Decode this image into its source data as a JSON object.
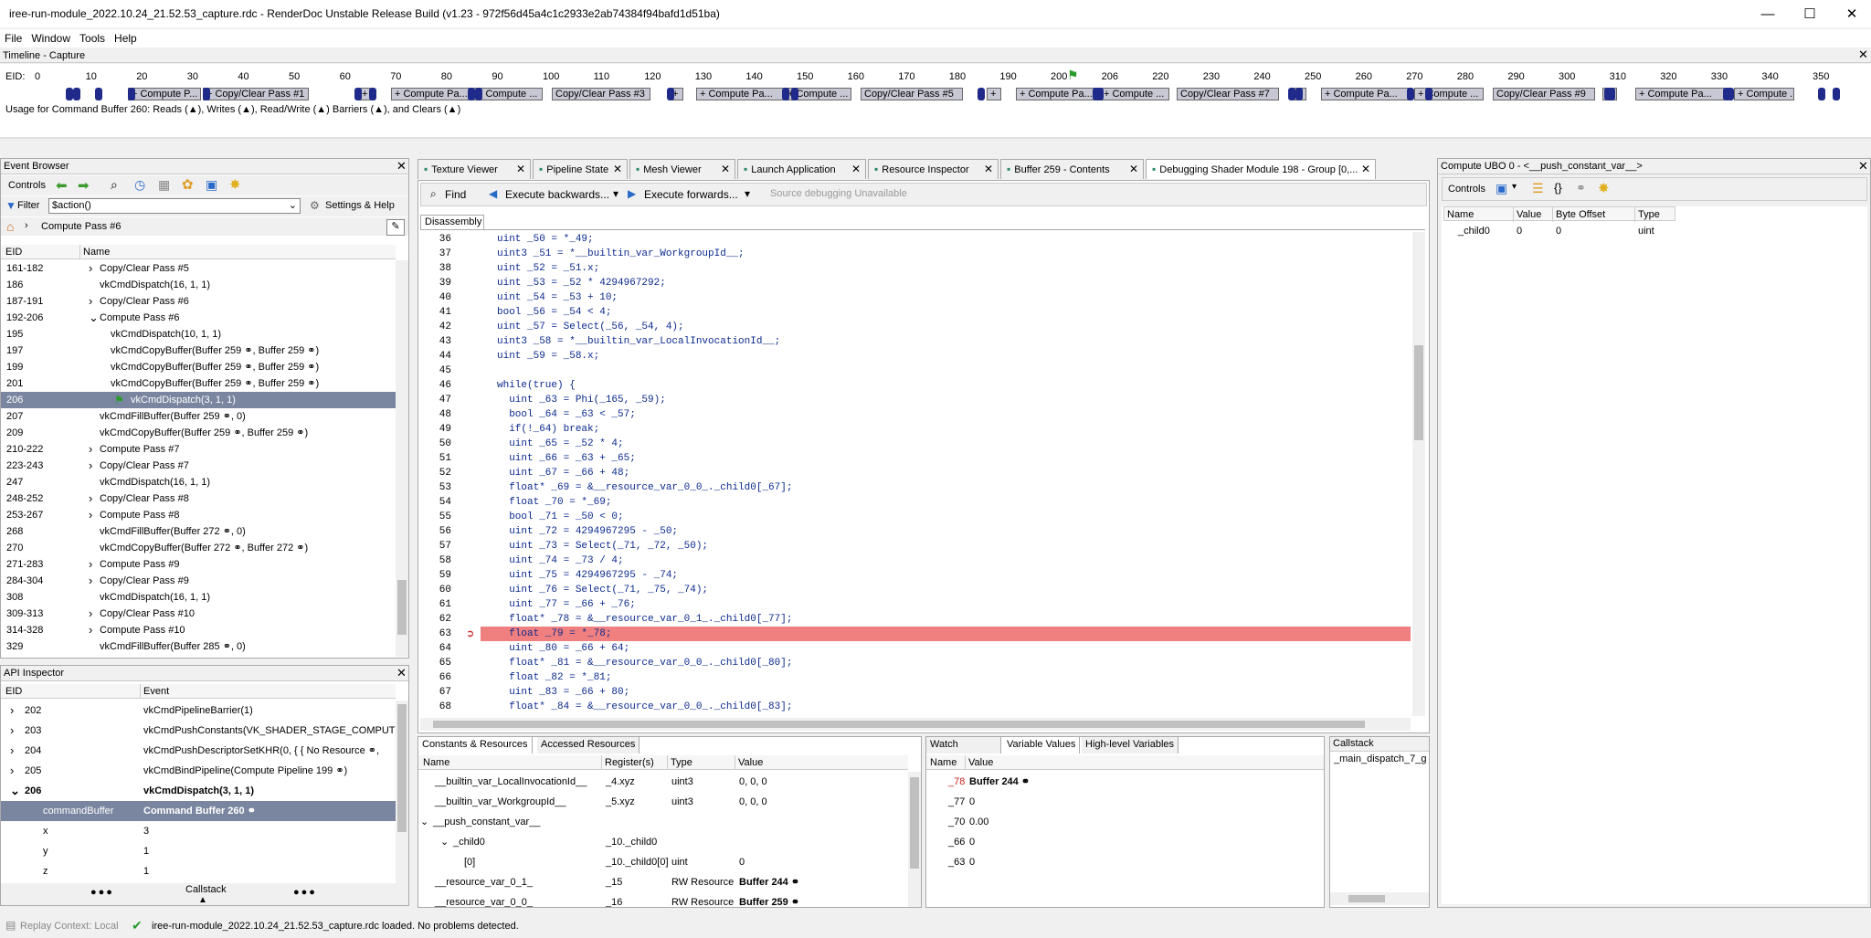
{
  "window": {
    "title": "iree-run-module_2022.10.24_21.52.53_capture.rdc - RenderDoc Unstable Release Build (v1.23 - 972f56d45a4c1c2933e2ab74384f94bafd1d51ba)",
    "minimize": "—",
    "maximize": "☐",
    "close": "✕"
  },
  "menu": [
    "File",
    "Window",
    "Tools",
    "Help"
  ],
  "timeline": {
    "title": "Timeline - Capture",
    "eid_label": "EID:",
    "ticks": [
      "0",
      "10",
      "20",
      "30",
      "40",
      "50",
      "60",
      "70",
      "80",
      "90",
      "100",
      "110",
      "120",
      "130",
      "140",
      "150",
      "160",
      "170",
      "180",
      "190",
      "200",
      "206",
      "220",
      "230",
      "240",
      "250",
      "260",
      "270",
      "280",
      "290",
      "300",
      "310",
      "320",
      "330",
      "340",
      "350"
    ],
    "segments": [
      "+ Compute P...",
      "+ Copy/Clear Pass #1",
      "+",
      "+ Compute Pa...",
      "+ Compute ...",
      "Copy/Clear Pass #3",
      "+",
      "+ Compute Pa...",
      "+ Compute ...",
      "Copy/Clear Pass #5",
      "+",
      "+ Compute Pa...",
      "+ Compute ...",
      "Copy/Clear Pass #7",
      "+",
      "+ Compute Pa...",
      "+ Compute ...",
      "Copy/Clear Pass #9",
      "+",
      "+ Compute Pa...",
      "+ Compute ..."
    ],
    "usage": "Usage for Command Buffer 260: Reads (▲), Writes (▲), Read/Write (▲) Barriers (▲), and Clears (▲)"
  },
  "event_browser": {
    "title": "Event Browser",
    "controls": "Controls",
    "filter_label": "Filter",
    "filter_value": "$action()",
    "settings": "Settings & Help",
    "breadcrumb": "Compute Pass #6",
    "col_eid": "EID",
    "col_name": "Name",
    "rows": [
      {
        "eid": "161-182",
        "name": "Copy/Clear Pass #5",
        "arrow": "›"
      },
      {
        "eid": "186",
        "name": "vkCmdDispatch(16, 1, 1)",
        "arrow": ""
      },
      {
        "eid": "187-191",
        "name": "Copy/Clear Pass #6",
        "arrow": "›"
      },
      {
        "eid": "192-206",
        "name": "Compute Pass #6",
        "arrow": "⌄"
      },
      {
        "eid": "195",
        "name": "vkCmdDispatch(10, 1, 1)",
        "arrow": ""
      },
      {
        "eid": "197",
        "name": "vkCmdCopyBuffer(Buffer 259 ⚭, Buffer 259 ⚭)",
        "arrow": ""
      },
      {
        "eid": "199",
        "name": "vkCmdCopyBuffer(Buffer 259 ⚭, Buffer 259 ⚭)",
        "arrow": ""
      },
      {
        "eid": "201",
        "name": "vkCmdCopyBuffer(Buffer 259 ⚭, Buffer 259 ⚭)",
        "arrow": ""
      },
      {
        "eid": "206",
        "name": "vkCmdDispatch(3, 1, 1)",
        "arrow": ""
      },
      {
        "eid": "207",
        "name": "vkCmdFillBuffer(Buffer 259 ⚭, 0)",
        "arrow": ""
      },
      {
        "eid": "209",
        "name": "vkCmdCopyBuffer(Buffer 259 ⚭, Buffer 259 ⚭)",
        "arrow": ""
      },
      {
        "eid": "210-222",
        "name": "Compute Pass #7",
        "arrow": "›"
      },
      {
        "eid": "223-243",
        "name": "Copy/Clear Pass #7",
        "arrow": "›"
      },
      {
        "eid": "247",
        "name": "vkCmdDispatch(16, 1, 1)",
        "arrow": ""
      },
      {
        "eid": "248-252",
        "name": "Copy/Clear Pass #8",
        "arrow": "›"
      },
      {
        "eid": "253-267",
        "name": "Compute Pass #8",
        "arrow": "›"
      },
      {
        "eid": "268",
        "name": "vkCmdFillBuffer(Buffer 272 ⚭, 0)",
        "arrow": ""
      },
      {
        "eid": "270",
        "name": "vkCmdCopyBuffer(Buffer 272 ⚭, Buffer 272 ⚭)",
        "arrow": ""
      },
      {
        "eid": "271-283",
        "name": "Compute Pass #9",
        "arrow": "›"
      },
      {
        "eid": "284-304",
        "name": "Copy/Clear Pass #9",
        "arrow": "›"
      },
      {
        "eid": "308",
        "name": "vkCmdDispatch(16, 1, 1)",
        "arrow": ""
      },
      {
        "eid": "309-313",
        "name": "Copy/Clear Pass #10",
        "arrow": "›"
      },
      {
        "eid": "314-328",
        "name": "Compute Pass #10",
        "arrow": "›"
      },
      {
        "eid": "329",
        "name": "vkCmdFillBuffer(Buffer 285 ⚭, 0)",
        "arrow": ""
      }
    ]
  },
  "api_inspector": {
    "title": "API Inspector",
    "col_eid": "EID",
    "col_event": "Event",
    "rows": [
      {
        "eid": "202",
        "event": "vkCmdPipelineBarrier(1)"
      },
      {
        "eid": "203",
        "event": "vkCmdPushConstants(VK_SHADER_STAGE_COMPUTE..."
      },
      {
        "eid": "204",
        "event": "vkCmdPushDescriptorSetKHR(0, { { No Resource ⚭,"
      },
      {
        "eid": "205",
        "event": "vkCmdBindPipeline(Compute Pipeline 199 ⚭)"
      },
      {
        "eid": "206",
        "event": "vkCmdDispatch(3, 1, 1)"
      },
      {
        "eid": "commandBuffer",
        "event": "Command Buffer 260 ⚭"
      },
      {
        "eid": "x",
        "event": "3"
      },
      {
        "eid": "y",
        "event": "1"
      },
      {
        "eid": "z",
        "event": "1"
      }
    ],
    "footer_left": "●●●",
    "footer_mid": "Callstack",
    "footer_right": "●●●"
  },
  "tabs": [
    "Texture Viewer",
    "Pipeline State",
    "Mesh Viewer",
    "Launch Application",
    "Resource Inspector",
    "Buffer 259 - Contents",
    "Debugging Shader Module 198 - Group [0,..."
  ],
  "debug": {
    "find": "Find",
    "exec_back": "Execute backwards...",
    "exec_fwd": "Execute forwards...",
    "source_unavail": "Source debugging Unavailable",
    "disasm_tab": "Disassembly",
    "lines": [
      {
        "n": "36",
        "c": "uint _50 = *_49;"
      },
      {
        "n": "37",
        "c": "uint3 _51 = *__builtin_var_WorkgroupId__;"
      },
      {
        "n": "38",
        "c": "uint _52 = _51.x;"
      },
      {
        "n": "39",
        "c": "uint _53 = _52 * 4294967292;"
      },
      {
        "n": "40",
        "c": "uint _54 = _53 + 10;"
      },
      {
        "n": "41",
        "c": "bool _56 = _54 < 4;"
      },
      {
        "n": "42",
        "c": "uint _57 = Select(_56, _54, 4);"
      },
      {
        "n": "43",
        "c": "uint3 _58 = *__builtin_var_LocalInvocationId__;"
      },
      {
        "n": "44",
        "c": "uint _59 = _58.x;"
      },
      {
        "n": "45",
        "c": ""
      },
      {
        "n": "46",
        "c": "while(true) {"
      },
      {
        "n": "47",
        "c": "  uint _63 = Phi(_165, _59);"
      },
      {
        "n": "48",
        "c": "  bool _64 = _63 < _57;"
      },
      {
        "n": "49",
        "c": "  if(!_64) break;"
      },
      {
        "n": "50",
        "c": "  uint _65 = _52 * 4;"
      },
      {
        "n": "51",
        "c": "  uint _66 = _63 + _65;"
      },
      {
        "n": "52",
        "c": "  uint _67 = _66 + 48;"
      },
      {
        "n": "53",
        "c": "  float* _69 = &__resource_var_0_0_._child0[_67];"
      },
      {
        "n": "54",
        "c": "  float _70 = *_69;"
      },
      {
        "n": "55",
        "c": "  bool _71 = _50 < 0;"
      },
      {
        "n": "56",
        "c": "  uint _72 = 4294967295 - _50;"
      },
      {
        "n": "57",
        "c": "  uint _73 = Select(_71, _72, _50);"
      },
      {
        "n": "58",
        "c": "  uint _74 = _73 / 4;"
      },
      {
        "n": "59",
        "c": "  uint _75 = 4294967295 - _74;"
      },
      {
        "n": "60",
        "c": "  uint _76 = Select(_71, _75, _74);"
      },
      {
        "n": "61",
        "c": "  uint _77 = _66 + _76;"
      },
      {
        "n": "62",
        "c": "  float* _78 = &__resource_var_0_1_._child0[_77];"
      },
      {
        "n": "63",
        "c": "  float _79 = *_78;"
      },
      {
        "n": "64",
        "c": "  uint _80 = _66 + 64;"
      },
      {
        "n": "65",
        "c": "  float* _81 = &__resource_var_0_0_._child0[_80];"
      },
      {
        "n": "66",
        "c": "  float _82 = *_81;"
      },
      {
        "n": "67",
        "c": "  uint _83 = _66 + 80;"
      },
      {
        "n": "68",
        "c": "  float* _84 = &__resource_var_0_0_._child0[_83];"
      }
    ]
  },
  "resources": {
    "tab1": "Constants & Resources",
    "tab2": "Accessed Resources",
    "cols": [
      "Name",
      "Register(s)",
      "Type",
      "Value"
    ],
    "rows": [
      {
        "name": "__builtin_var_LocalInvocationId__",
        "reg": "_4.xyz",
        "type": "uint3",
        "value": "0, 0, 0"
      },
      {
        "name": "__builtin_var_WorkgroupId__",
        "reg": "_5.xyz",
        "type": "uint3",
        "value": "0, 0, 0"
      },
      {
        "name": "__push_constant_var__",
        "reg": "",
        "type": "",
        "value": ""
      },
      {
        "name": "_child0",
        "reg": "_10._child0",
        "type": "",
        "value": ""
      },
      {
        "name": "[0]",
        "reg": "_10._child0[0]",
        "type": "uint",
        "value": "0"
      },
      {
        "name": "__resource_var_0_1_",
        "reg": "_15",
        "type": "RW Resource",
        "value": "Buffer 244 ⚭"
      },
      {
        "name": "__resource_var_0_0_",
        "reg": "_16",
        "type": "RW Resource",
        "value": "Buffer 259 ⚭"
      }
    ]
  },
  "watch": {
    "tab1": "Watch",
    "tab2": "Variable Values",
    "tab3": "High-level Variables",
    "cols": [
      "Name",
      "Value"
    ],
    "rows": [
      {
        "name": "_78",
        "value": "Buffer 244 ⚭"
      },
      {
        "name": "_77",
        "value": "0"
      },
      {
        "name": "_70",
        "value": "0.00"
      },
      {
        "name": "_66",
        "value": "0"
      },
      {
        "name": "_63",
        "value": "0"
      }
    ]
  },
  "callstack": {
    "title": "Callstack",
    "entry": "_main_dispatch_7_g"
  },
  "ubo": {
    "title": "Compute UBO 0 - <__push_constant_var__>",
    "controls": "Controls",
    "cols": [
      "Name",
      "Value",
      "Byte Offset",
      "Type"
    ],
    "row": {
      "name": "_child0",
      "value": "0",
      "offset": "0",
      "type": "uint"
    }
  },
  "status": {
    "context": "Replay Context: Local",
    "msg": "iree-run-module_2022.10.24_21.52.53_capture.rdc loaded. No problems detected."
  }
}
